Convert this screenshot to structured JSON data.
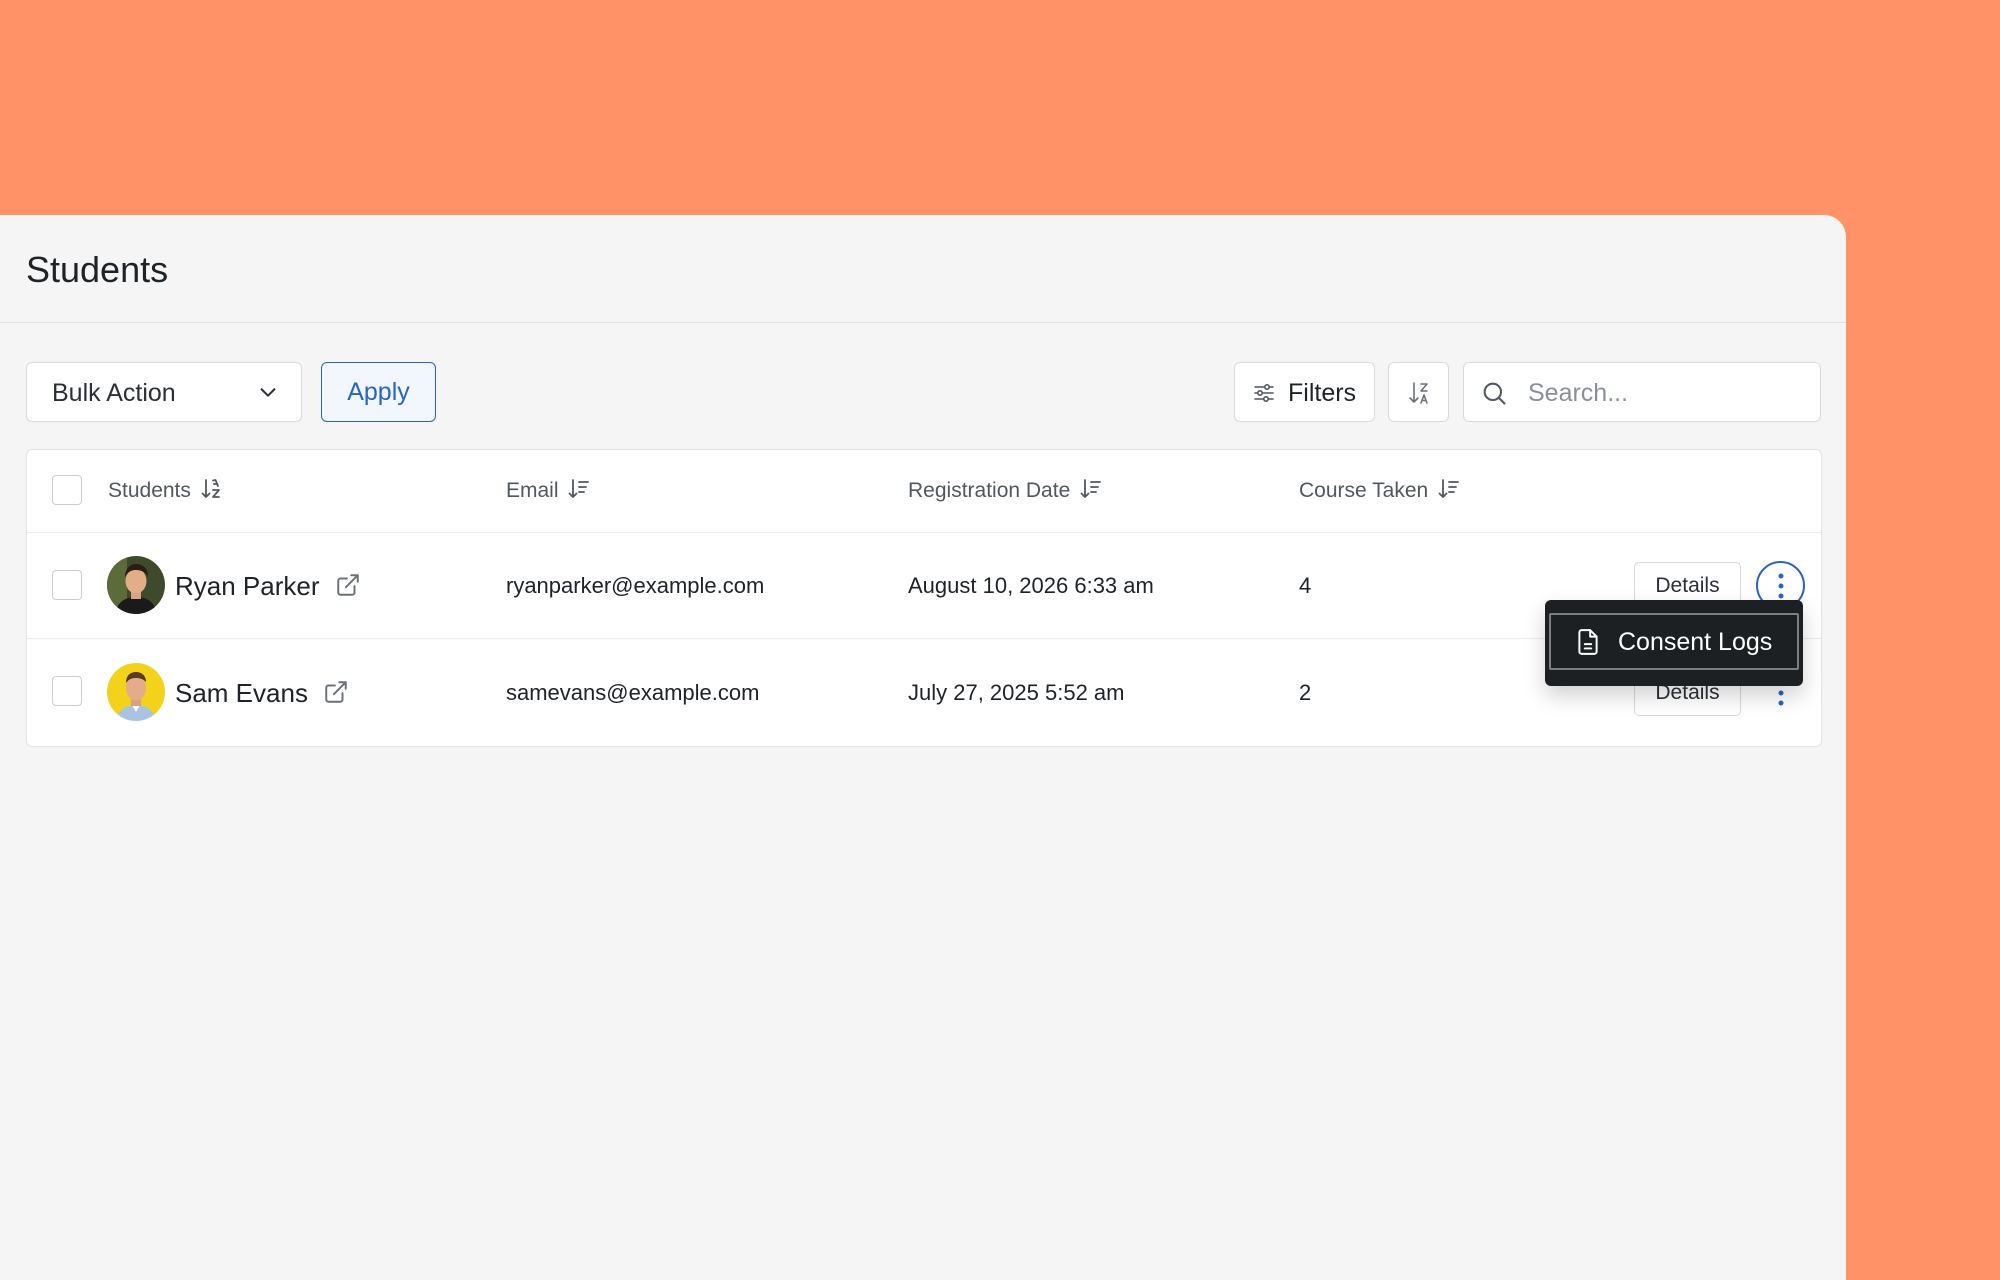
{
  "page": {
    "title": "Students"
  },
  "toolbar": {
    "bulk_action_label": "Bulk Action",
    "apply_label": "Apply",
    "filters_label": "Filters",
    "search_placeholder": "Search..."
  },
  "table": {
    "columns": [
      "Students",
      "Email",
      "Registration Date",
      "Course Taken"
    ],
    "rows": [
      {
        "name": "Ryan Parker",
        "email": "ryanparker@example.com",
        "registration_date": "August 10, 2026 6:33 am",
        "course_taken": "4",
        "details_label": "Details"
      },
      {
        "name": "Sam Evans",
        "email": "samevans@example.com",
        "registration_date": "July 27, 2025 5:52 am",
        "course_taken": "2",
        "details_label": "Details"
      }
    ]
  },
  "row_menu": {
    "items": [
      "Consent Logs"
    ]
  },
  "colors": {
    "background": "#ff9266",
    "accent": "#2a63c6",
    "menu_bg": "#1d2022"
  },
  "icons": [
    "chevron-down-icon",
    "filter-sliders-icon",
    "sort-az-icon",
    "search-icon",
    "sort-icon",
    "external-link-icon",
    "kebab-menu-icon",
    "document-icon"
  ]
}
